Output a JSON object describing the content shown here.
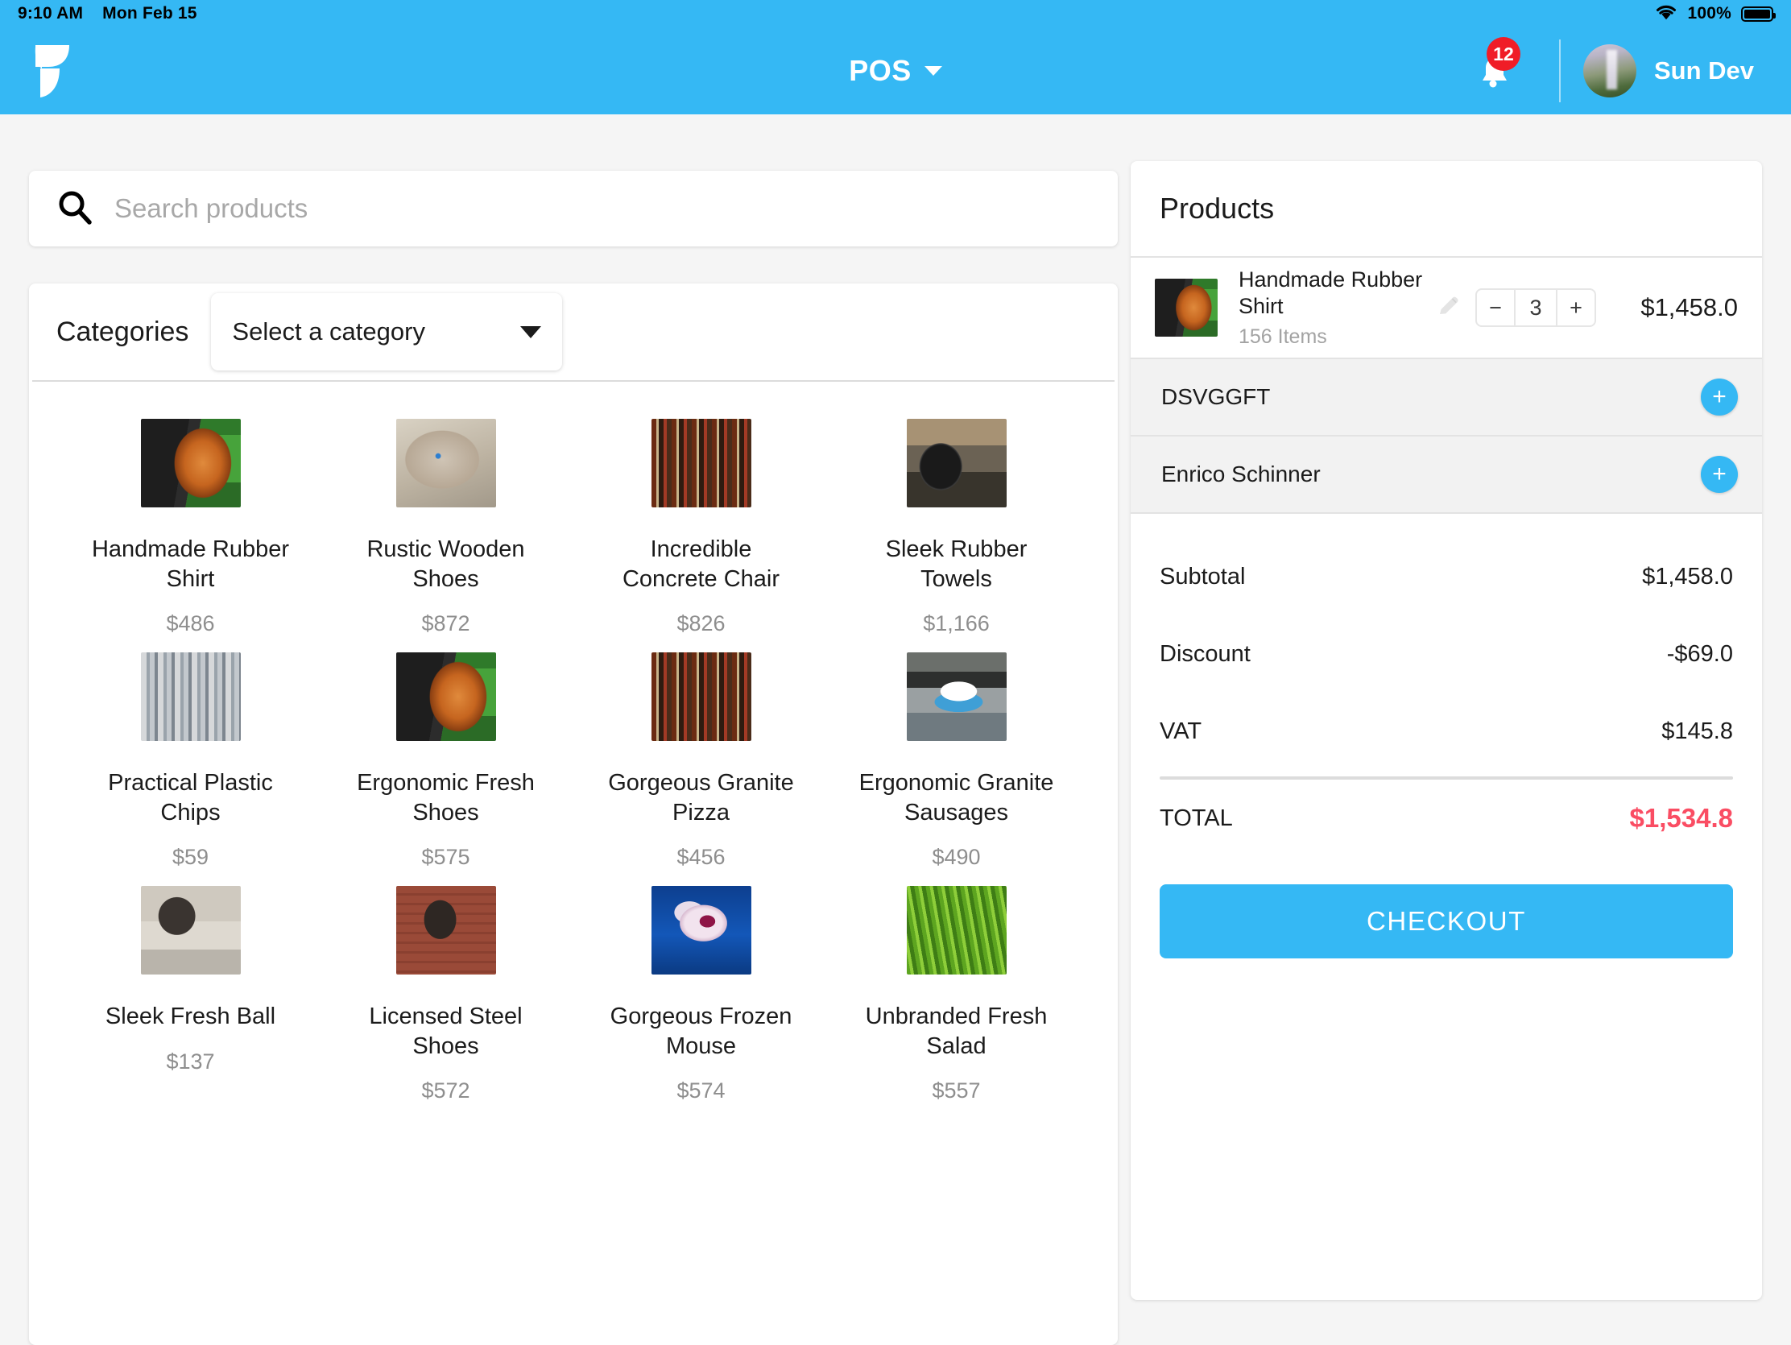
{
  "statusbar": {
    "time": "9:10 AM",
    "date": "Mon Feb 15",
    "battery_percent": "100%",
    "wifi_icon": "wifi-icon",
    "battery_icon": "battery-icon"
  },
  "appbar": {
    "logo_icon": "app-logo-icon",
    "title": "POS",
    "dropdown_icon": "chevron-down-icon",
    "notification_icon": "bell-icon",
    "notification_count": "12",
    "user_name": "Sun Dev",
    "avatar_icon": "avatar"
  },
  "search": {
    "icon": "search-icon",
    "value": "",
    "placeholder": "Search products"
  },
  "categories": {
    "label": "Categories",
    "selected": "Select a category",
    "caret_icon": "chevron-down-icon"
  },
  "products": [
    {
      "name": "Handmade Rubber Shirt",
      "price": "$486",
      "thumb": "th-coil"
    },
    {
      "name": "Rustic Wooden Shoes",
      "price": "$872",
      "thumb": "th-cat1"
    },
    {
      "name": "Incredible Concrete Chair",
      "price": "$826",
      "thumb": "th-bottles"
    },
    {
      "name": "Sleek Rubber Towels",
      "price": "$1,166",
      "thumb": "th-head"
    },
    {
      "name": "Practical Plastic Chips",
      "price": "$59",
      "thumb": "th-city"
    },
    {
      "name": "Ergonomic Fresh Shoes",
      "price": "$575",
      "thumb": "th-coil"
    },
    {
      "name": "Gorgeous Granite Pizza",
      "price": "$456",
      "thumb": "th-bottles"
    },
    {
      "name": "Ergonomic Granite Sausages",
      "price": "$490",
      "thumb": "th-car"
    },
    {
      "name": "Sleek Fresh Ball",
      "price": "$137",
      "thumb": "th-cat2"
    },
    {
      "name": "Licensed Steel Shoes",
      "price": "$572",
      "thumb": "th-cat3"
    },
    {
      "name": "Gorgeous Frozen Mouse",
      "price": "$574",
      "thumb": "th-orchid"
    },
    {
      "name": "Unbranded Fresh Salad",
      "price": "$557",
      "thumb": "th-grass"
    }
  ],
  "cart": {
    "header": "Products",
    "item": {
      "name": "Handmade Rubber Shirt",
      "stock": "156 Items",
      "edit_icon": "pencil-icon",
      "decrement_label": "−",
      "quantity": "3",
      "increment_label": "+",
      "line_total": "$1,458.0",
      "thumb": "th-coil"
    },
    "extra_rows": [
      {
        "label": "DSVGGFT",
        "add_label": "+"
      },
      {
        "label": "Enrico Schinner",
        "add_label": "+"
      }
    ],
    "totals": [
      {
        "label": "Subtotal",
        "value": "$1,458.0"
      },
      {
        "label": "Discount",
        "value": "-$69.0"
      },
      {
        "label": "VAT",
        "value": "$145.8"
      }
    ],
    "grand_total": {
      "label": "TOTAL",
      "value": "$1,534.8"
    },
    "checkout_label": "CHECKOUT"
  },
  "colors": {
    "brand_blue": "#35b8f4",
    "total_red": "#fa4d63",
    "badge_red": "#f01d27",
    "page_bg": "#f5f5f5"
  }
}
